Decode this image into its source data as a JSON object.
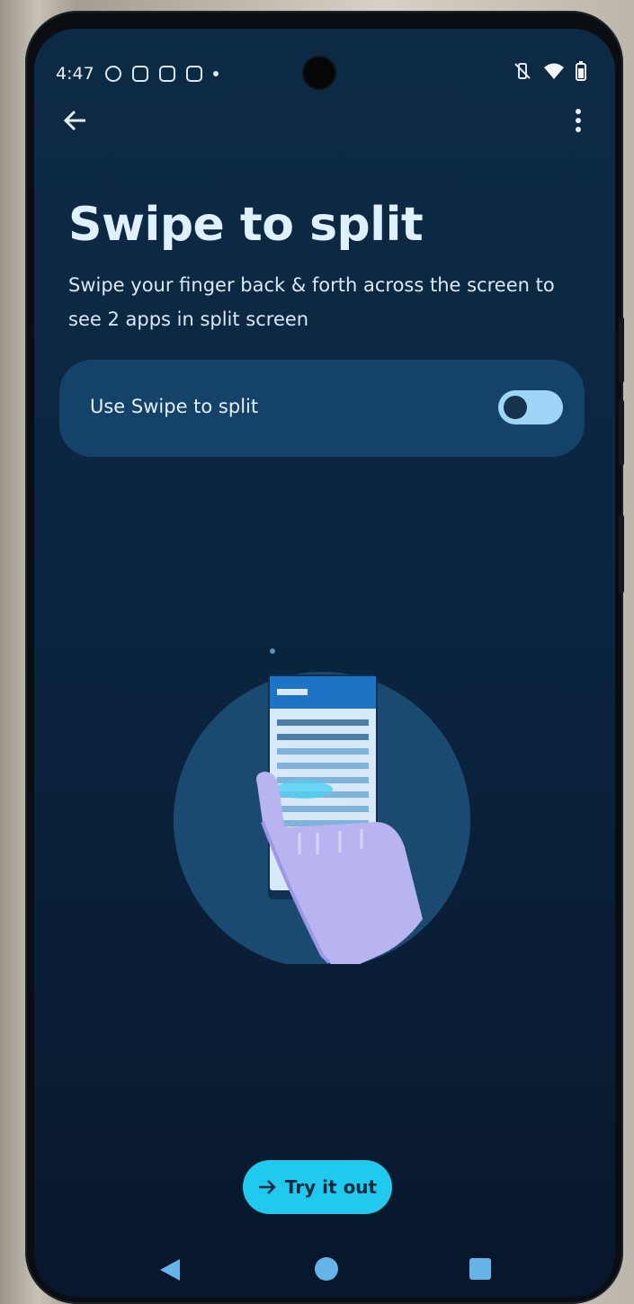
{
  "status_bar": {
    "time": "4:47"
  },
  "page": {
    "title": "Swipe to split",
    "description": "Swipe your finger back & forth across the screen to see 2 apps in split screen"
  },
  "setting": {
    "label": "Use Swipe to split",
    "enabled": false
  },
  "action": {
    "label": "Try it out"
  },
  "icons": {
    "back": "arrow-left-icon",
    "more": "more-vert-icon",
    "try": "arrow-right-icon"
  },
  "colors": {
    "background": "#0b2540",
    "card": "#144268",
    "switch_track": "#9fd5f6",
    "accent_button": "#22c9ee",
    "title_text": "#dff1ff",
    "nav_icons": "#66b4e8"
  }
}
